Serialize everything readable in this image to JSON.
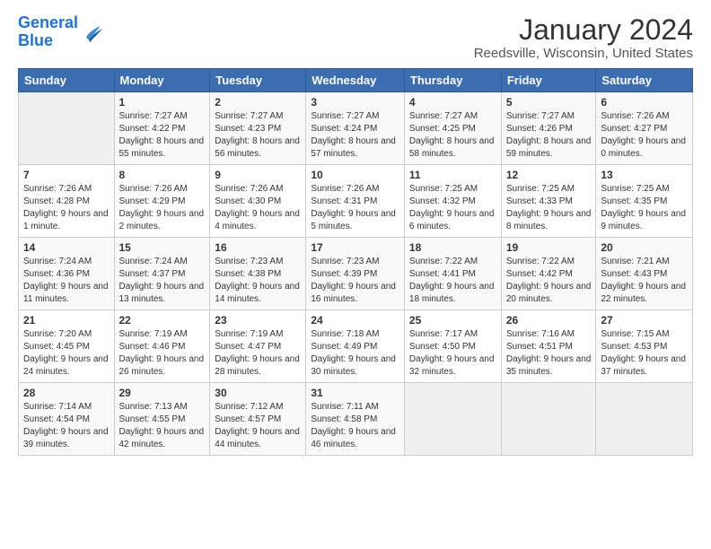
{
  "app": {
    "logo_text_general": "General",
    "logo_text_blue": "Blue"
  },
  "header": {
    "title": "January 2024",
    "subtitle": "Reedsville, Wisconsin, United States"
  },
  "calendar": {
    "days_of_week": [
      "Sunday",
      "Monday",
      "Tuesday",
      "Wednesday",
      "Thursday",
      "Friday",
      "Saturday"
    ],
    "weeks": [
      [
        {
          "day": "",
          "sunrise": "",
          "sunset": "",
          "daylight": ""
        },
        {
          "day": "1",
          "sunrise": "7:27 AM",
          "sunset": "4:22 PM",
          "daylight": "8 hours and 55 minutes."
        },
        {
          "day": "2",
          "sunrise": "7:27 AM",
          "sunset": "4:23 PM",
          "daylight": "8 hours and 56 minutes."
        },
        {
          "day": "3",
          "sunrise": "7:27 AM",
          "sunset": "4:24 PM",
          "daylight": "8 hours and 57 minutes."
        },
        {
          "day": "4",
          "sunrise": "7:27 AM",
          "sunset": "4:25 PM",
          "daylight": "8 hours and 58 minutes."
        },
        {
          "day": "5",
          "sunrise": "7:27 AM",
          "sunset": "4:26 PM",
          "daylight": "8 hours and 59 minutes."
        },
        {
          "day": "6",
          "sunrise": "7:26 AM",
          "sunset": "4:27 PM",
          "daylight": "9 hours and 0 minutes."
        }
      ],
      [
        {
          "day": "7",
          "sunrise": "7:26 AM",
          "sunset": "4:28 PM",
          "daylight": "9 hours and 1 minute."
        },
        {
          "day": "8",
          "sunrise": "7:26 AM",
          "sunset": "4:29 PM",
          "daylight": "9 hours and 2 minutes."
        },
        {
          "day": "9",
          "sunrise": "7:26 AM",
          "sunset": "4:30 PM",
          "daylight": "9 hours and 4 minutes."
        },
        {
          "day": "10",
          "sunrise": "7:26 AM",
          "sunset": "4:31 PM",
          "daylight": "9 hours and 5 minutes."
        },
        {
          "day": "11",
          "sunrise": "7:25 AM",
          "sunset": "4:32 PM",
          "daylight": "9 hours and 6 minutes."
        },
        {
          "day": "12",
          "sunrise": "7:25 AM",
          "sunset": "4:33 PM",
          "daylight": "9 hours and 8 minutes."
        },
        {
          "day": "13",
          "sunrise": "7:25 AM",
          "sunset": "4:35 PM",
          "daylight": "9 hours and 9 minutes."
        }
      ],
      [
        {
          "day": "14",
          "sunrise": "7:24 AM",
          "sunset": "4:36 PM",
          "daylight": "9 hours and 11 minutes."
        },
        {
          "day": "15",
          "sunrise": "7:24 AM",
          "sunset": "4:37 PM",
          "daylight": "9 hours and 13 minutes."
        },
        {
          "day": "16",
          "sunrise": "7:23 AM",
          "sunset": "4:38 PM",
          "daylight": "9 hours and 14 minutes."
        },
        {
          "day": "17",
          "sunrise": "7:23 AM",
          "sunset": "4:39 PM",
          "daylight": "9 hours and 16 minutes."
        },
        {
          "day": "18",
          "sunrise": "7:22 AM",
          "sunset": "4:41 PM",
          "daylight": "9 hours and 18 minutes."
        },
        {
          "day": "19",
          "sunrise": "7:22 AM",
          "sunset": "4:42 PM",
          "daylight": "9 hours and 20 minutes."
        },
        {
          "day": "20",
          "sunrise": "7:21 AM",
          "sunset": "4:43 PM",
          "daylight": "9 hours and 22 minutes."
        }
      ],
      [
        {
          "day": "21",
          "sunrise": "7:20 AM",
          "sunset": "4:45 PM",
          "daylight": "9 hours and 24 minutes."
        },
        {
          "day": "22",
          "sunrise": "7:19 AM",
          "sunset": "4:46 PM",
          "daylight": "9 hours and 26 minutes."
        },
        {
          "day": "23",
          "sunrise": "7:19 AM",
          "sunset": "4:47 PM",
          "daylight": "9 hours and 28 minutes."
        },
        {
          "day": "24",
          "sunrise": "7:18 AM",
          "sunset": "4:49 PM",
          "daylight": "9 hours and 30 minutes."
        },
        {
          "day": "25",
          "sunrise": "7:17 AM",
          "sunset": "4:50 PM",
          "daylight": "9 hours and 32 minutes."
        },
        {
          "day": "26",
          "sunrise": "7:16 AM",
          "sunset": "4:51 PM",
          "daylight": "9 hours and 35 minutes."
        },
        {
          "day": "27",
          "sunrise": "7:15 AM",
          "sunset": "4:53 PM",
          "daylight": "9 hours and 37 minutes."
        }
      ],
      [
        {
          "day": "28",
          "sunrise": "7:14 AM",
          "sunset": "4:54 PM",
          "daylight": "9 hours and 39 minutes."
        },
        {
          "day": "29",
          "sunrise": "7:13 AM",
          "sunset": "4:55 PM",
          "daylight": "9 hours and 42 minutes."
        },
        {
          "day": "30",
          "sunrise": "7:12 AM",
          "sunset": "4:57 PM",
          "daylight": "9 hours and 44 minutes."
        },
        {
          "day": "31",
          "sunrise": "7:11 AM",
          "sunset": "4:58 PM",
          "daylight": "9 hours and 46 minutes."
        },
        {
          "day": "",
          "sunrise": "",
          "sunset": "",
          "daylight": ""
        },
        {
          "day": "",
          "sunrise": "",
          "sunset": "",
          "daylight": ""
        },
        {
          "day": "",
          "sunrise": "",
          "sunset": "",
          "daylight": ""
        }
      ]
    ],
    "sunrise_label": "Sunrise:",
    "sunset_label": "Sunset:",
    "daylight_label": "Daylight:"
  }
}
